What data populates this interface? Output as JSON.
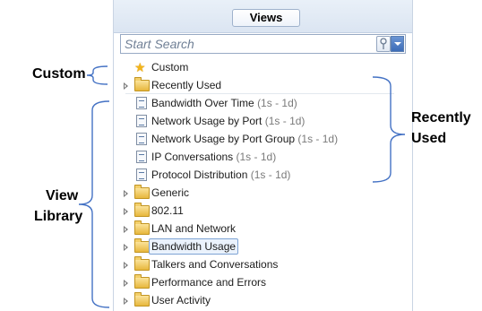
{
  "panel": {
    "tab_label": "Views",
    "search_placeholder": "Start Search"
  },
  "tree": {
    "custom": "Custom",
    "recently_used": "Recently Used",
    "recent_items": [
      {
        "name": "Bandwidth Over Time",
        "range": "(1s - 1d)"
      },
      {
        "name": "Network Usage by Port",
        "range": "(1s - 1d)"
      },
      {
        "name": "Network Usage by Port Group",
        "range": "(1s - 1d)"
      },
      {
        "name": "IP Conversations",
        "range": "(1s - 1d)"
      },
      {
        "name": "Protocol Distribution",
        "range": "(1s - 1d)"
      }
    ],
    "folders": [
      "Generic",
      "802.11",
      "LAN and Network",
      "Bandwidth Usage",
      "Talkers and Conversations",
      "Performance and Errors",
      "User Activity"
    ]
  },
  "annotations": {
    "custom": "Custom",
    "recently_used_line1": "Recently",
    "recently_used_line2": "Used",
    "view_library_line1": "View",
    "view_library_line2": "Library"
  },
  "colors": {
    "bracket": "#4472c4",
    "panel_border": "#c9d4e3",
    "selection": "#7ea3d4"
  }
}
